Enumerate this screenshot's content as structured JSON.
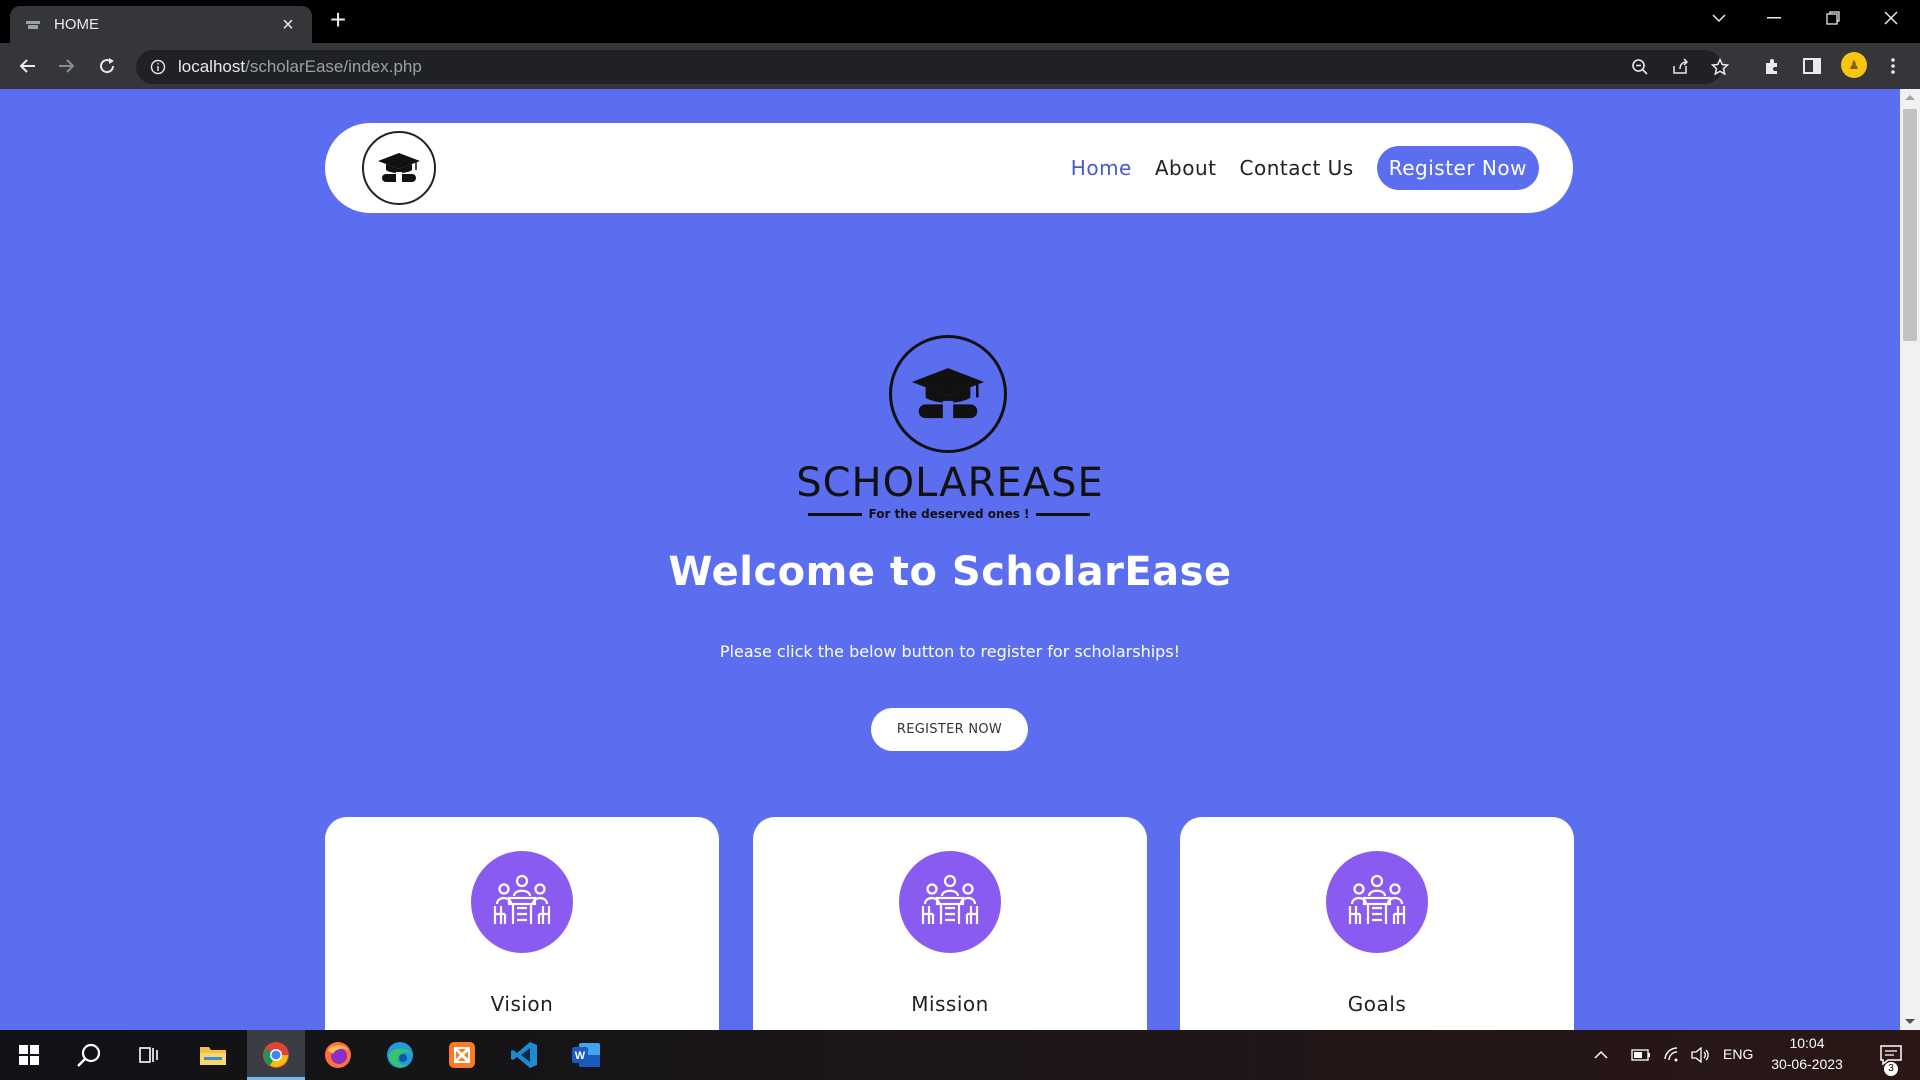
{
  "browser": {
    "tab_title": "HOME",
    "url_host": "localhost",
    "url_path": "/scholarEase/index.php"
  },
  "navbar": {
    "links": [
      "Home",
      "About",
      "Contact Us"
    ],
    "active": "Home",
    "register_label": "Register Now"
  },
  "hero": {
    "brand_name": "SCHOLAREASE",
    "tagline": "For the deserved ones !",
    "welcome_prefix": "Welcome to ",
    "welcome_brand": "ScholarEase",
    "subtitle": "Please click the below button to register for scholarships!",
    "button_label": "REGISTER NOW"
  },
  "cards": [
    {
      "title": "Vision",
      "icon": "meeting-icon"
    },
    {
      "title": "Mission",
      "icon": "meeting-icon"
    },
    {
      "title": "Goals",
      "icon": "meeting-icon"
    }
  ],
  "taskbar": {
    "apps": [
      "start",
      "search",
      "task-view",
      "file-explorer",
      "chrome",
      "firefox",
      "edge",
      "xampp",
      "vscode",
      "word"
    ],
    "language": "ENG",
    "time": "10:04",
    "date": "30-06-2023",
    "notification_count": "3"
  },
  "colors": {
    "page_bg": "#5b6ef0",
    "card_icon_bg": "#8a5bf0",
    "nav_active": "#4a57d6"
  }
}
